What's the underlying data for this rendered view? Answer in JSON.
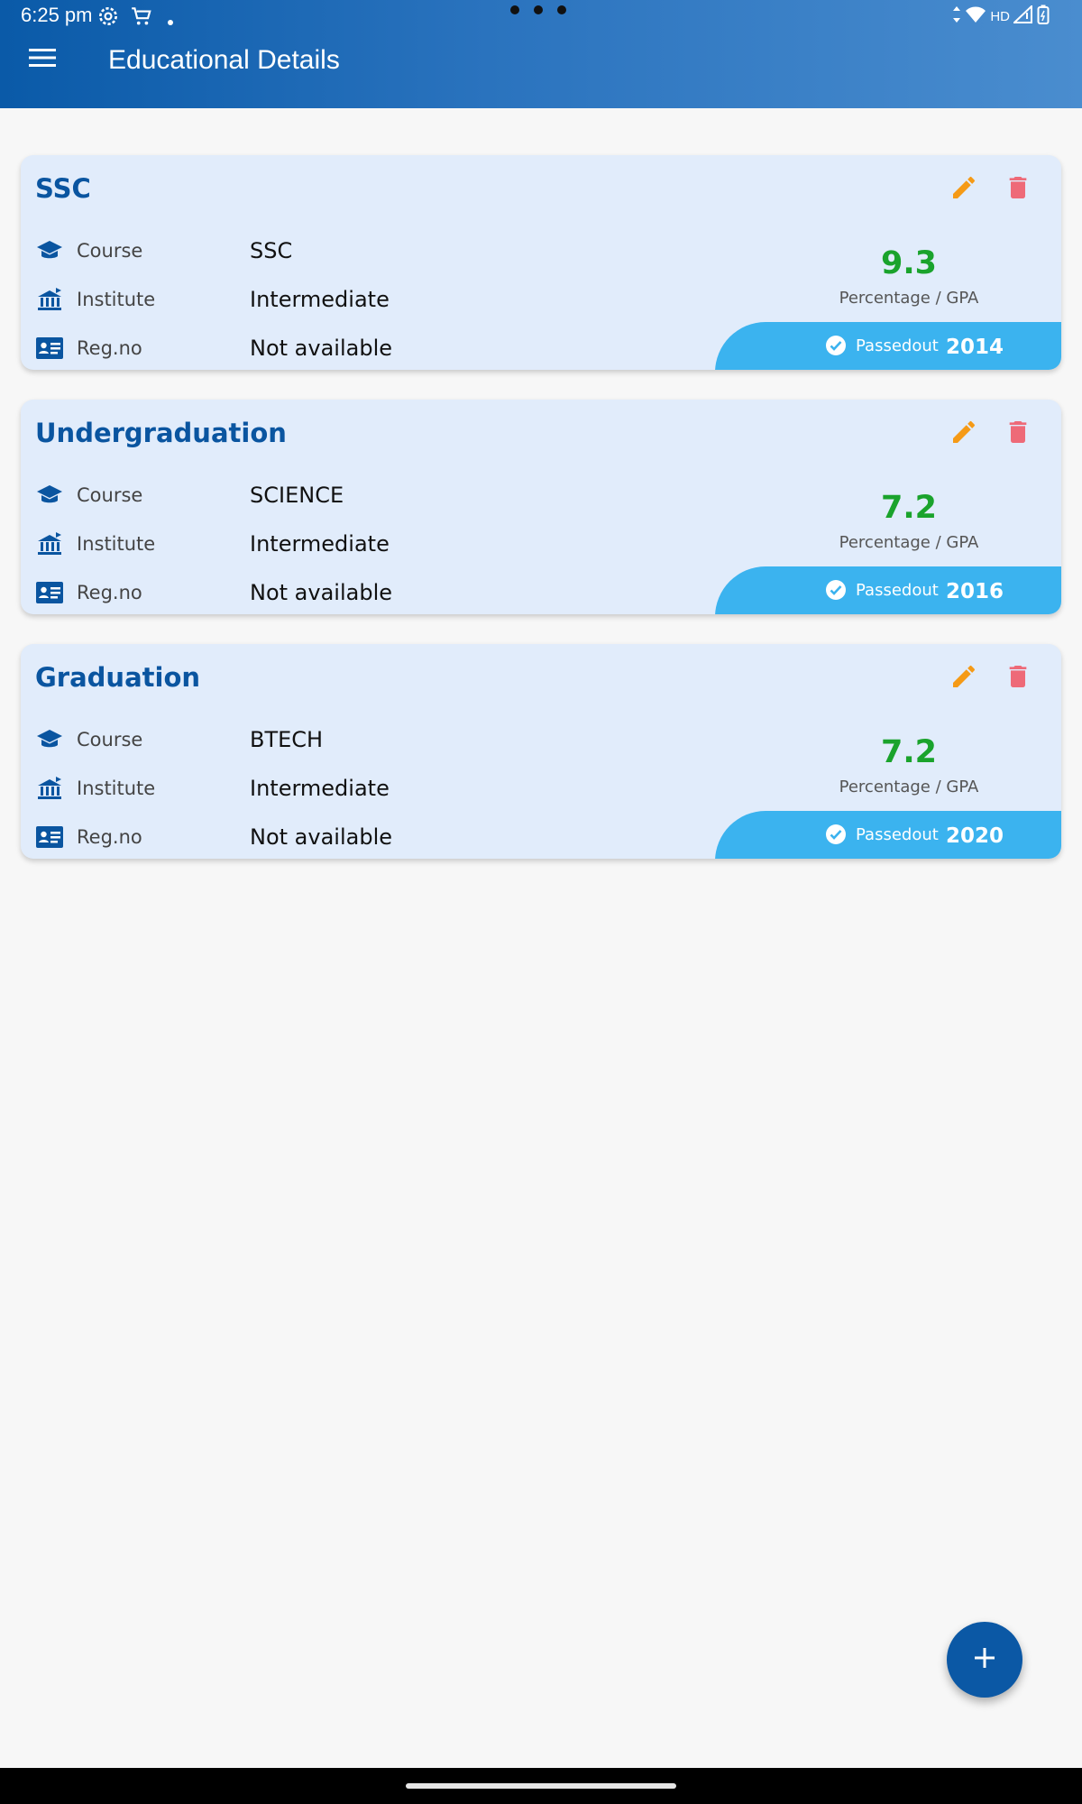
{
  "status_bar": {
    "time": "6:25 pm",
    "network_label": "HD"
  },
  "app_bar": {
    "title": "Educational Details"
  },
  "labels": {
    "course": "Course",
    "institute": "Institute",
    "reg_no": "Reg.no",
    "gpa_caption": "Percentage / GPA",
    "passed": "Passedout"
  },
  "records": [
    {
      "title": "SSC",
      "course": "SSC",
      "institute": "Intermediate",
      "reg_no": "Not available",
      "gpa": "9.3",
      "year": "2014"
    },
    {
      "title": "Undergraduation",
      "course": "SCIENCE",
      "institute": "Intermediate",
      "reg_no": "Not available",
      "gpa": "7.2",
      "year": "2016"
    },
    {
      "title": "Graduation",
      "course": "BTECH",
      "institute": "Intermediate",
      "reg_no": "Not available",
      "gpa": "7.2",
      "year": "2020"
    }
  ],
  "colors": {
    "primary": "#0a55a0",
    "card_bg": "#e1ecfb",
    "gpa": "#1aa32c",
    "badge": "#3bb3ef",
    "edit": "#f59a16",
    "delete": "#ee6a78"
  },
  "icons": [
    "menu-icon",
    "graduation-cap-icon",
    "institute-icon",
    "id-card-icon",
    "edit-icon",
    "delete-icon",
    "check-circle-icon",
    "add-icon"
  ]
}
